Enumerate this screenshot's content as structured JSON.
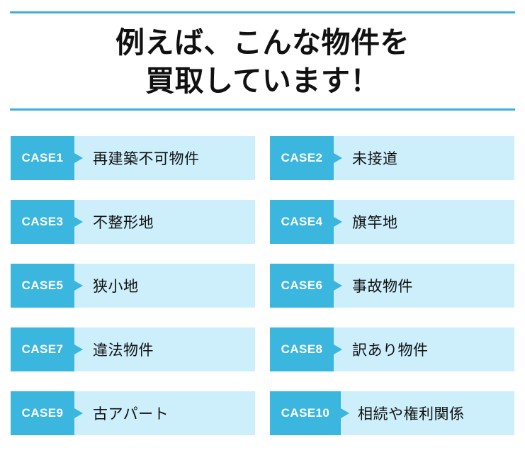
{
  "header": {
    "title": "例えば、こんな物件を\n買取しています！",
    "rule_color": "#3FAFD8"
  },
  "theme": {
    "badge_color": "#3BB6DE",
    "body_color": "#CCEFFB",
    "badge_text_color": "#FFFFFF",
    "label_text_color": "#111111"
  },
  "cases": [
    {
      "badge": "CASE1",
      "label": "再建築不可物件"
    },
    {
      "badge": "CASE2",
      "label": "未接道"
    },
    {
      "badge": "CASE3",
      "label": "不整形地"
    },
    {
      "badge": "CASE4",
      "label": "旗竿地"
    },
    {
      "badge": "CASE5",
      "label": "狭小地"
    },
    {
      "badge": "CASE6",
      "label": "事故物件"
    },
    {
      "badge": "CASE7",
      "label": "違法物件"
    },
    {
      "badge": "CASE8",
      "label": "訳あり物件"
    },
    {
      "badge": "CASE9",
      "label": "古アパート"
    },
    {
      "badge": "CASE10",
      "label": "相続や権利関係"
    }
  ]
}
